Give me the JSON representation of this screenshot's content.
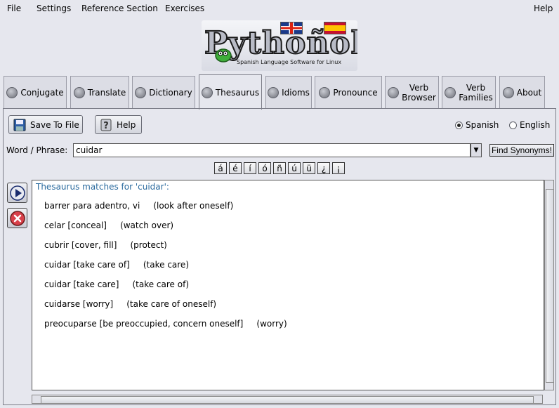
{
  "menubar": {
    "file": "File",
    "settings": "Settings",
    "reference": "Reference Section",
    "exercises": "Exercises",
    "help": "Help"
  },
  "logo": {
    "word": "Pythoñol",
    "subtitle": "Spanish Language Software for Linux"
  },
  "tabs": [
    {
      "label": "Conjugate"
    },
    {
      "label": "Translate"
    },
    {
      "label": "Dictionary"
    },
    {
      "label": "Thesaurus"
    },
    {
      "label": "Idioms"
    },
    {
      "label": "Pronounce"
    },
    {
      "label": "Verb\nBrowser"
    },
    {
      "label": "Verb\nFamilies"
    },
    {
      "label": "About"
    }
  ],
  "toolbar": {
    "save_label": "Save To File",
    "help_label": "Help"
  },
  "language": {
    "spanish": "Spanish",
    "english": "English",
    "selected": "Spanish"
  },
  "search": {
    "label": "Word / Phrase:",
    "value": "cuidar",
    "find_label": "Find Synonyms!"
  },
  "accents": [
    "á",
    "é",
    "í",
    "ó",
    "ñ",
    "ú",
    "ü",
    "¿",
    "¡"
  ],
  "results": {
    "title": "Thesaurus matches for 'cuidar':",
    "rows": [
      "barrer para adentro, vi     (look after oneself)",
      "celar [conceal]     (watch over)",
      "cubrir [cover, fill]     (protect)",
      "cuidar [take care of]     (take care)",
      "cuidar [take care]     (take care of)",
      "cuidarse [worry]     (take care of oneself)",
      "preocuparse [be preoccupied, concern oneself]     (worry)"
    ]
  },
  "colors": {
    "accent": "#2a6a9e",
    "background": "#e6e7ee"
  }
}
